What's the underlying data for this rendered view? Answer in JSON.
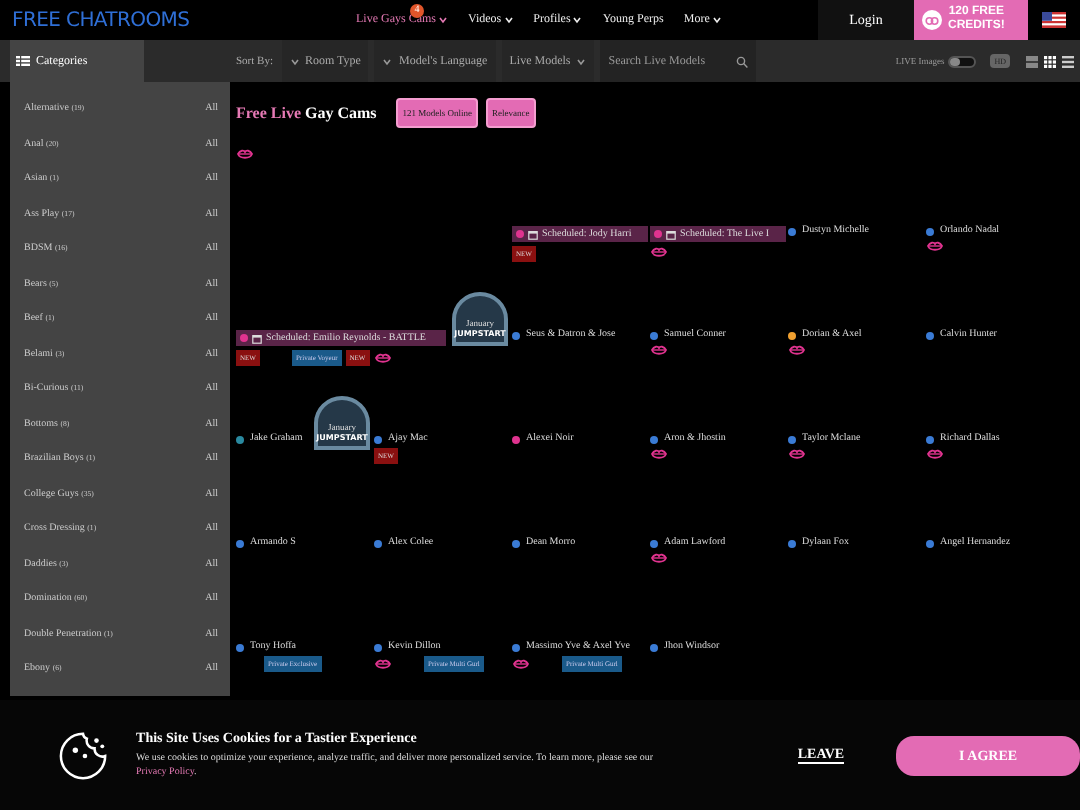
{
  "header": {
    "logo": "FREE CHATROOMS",
    "nav": [
      {
        "label": "Live Gays Cams",
        "selected": true,
        "dropdown": true,
        "badge": "4"
      },
      {
        "label": "Videos",
        "selected": false,
        "dropdown": true
      },
      {
        "label": "Profiles",
        "selected": false,
        "dropdown": true
      },
      {
        "label": "Young Perps",
        "selected": false,
        "dropdown": false
      },
      {
        "label": "More",
        "selected": false,
        "dropdown": true
      }
    ],
    "login": "Login",
    "credits": {
      "line1": "120 FREE",
      "line2": "CREDITS!"
    }
  },
  "toolbar": {
    "categories": "Categories",
    "sort_label": "Sort By:",
    "filters": [
      "Room Type",
      "Model's Language",
      "Live Models"
    ],
    "search": {
      "placeholder": "Search Live Models"
    },
    "live_images": {
      "label": "LIVE Images",
      "on": false
    },
    "hd": "HD"
  },
  "sidebar": {
    "items": [
      {
        "name": "Alternative",
        "count": "(19)",
        "all": "All"
      },
      {
        "name": "Anal",
        "count": "(20)",
        "all": "All"
      },
      {
        "name": "Asian",
        "count": "(1)",
        "all": "All"
      },
      {
        "name": "Ass Play",
        "count": "(17)",
        "all": "All"
      },
      {
        "name": "BDSM",
        "count": "(16)",
        "all": "All"
      },
      {
        "name": "Bears",
        "count": "(5)",
        "all": "All"
      },
      {
        "name": "Beef",
        "count": "(1)",
        "all": "All"
      },
      {
        "name": "Belami",
        "count": "(3)",
        "all": "All"
      },
      {
        "name": "Bi-Curious",
        "count": "(11)",
        "all": "All"
      },
      {
        "name": "Bottoms",
        "count": "(8)",
        "all": "All"
      },
      {
        "name": "Brazilian Boys",
        "count": "(1)",
        "all": "All"
      },
      {
        "name": "College Guys",
        "count": "(35)",
        "all": "All"
      },
      {
        "name": "Cross Dressing",
        "count": "(1)",
        "all": "All"
      },
      {
        "name": "Daddies",
        "count": "(3)",
        "all": "All"
      },
      {
        "name": "Domination",
        "count": "(60)",
        "all": "All"
      },
      {
        "name": "Double Penetration",
        "count": "(1)",
        "all": "All"
      },
      {
        "name": "Ebony",
        "count": "(6)",
        "all": "All"
      }
    ]
  },
  "main": {
    "title_accent": "Free Live",
    "title": "Gay Cams",
    "pills": [
      "121 Models Online",
      "Relevance"
    ]
  },
  "grid": [
    [
      {
        "kind": "blank"
      },
      {
        "kind": "blank"
      },
      {
        "kind": "scheduled",
        "name": "Scheduled: Jody Harri",
        "color": "#e0338f",
        "tags": [
          {
            "kind": "new",
            "text": "NEW"
          }
        ]
      },
      {
        "kind": "scheduled",
        "name": "Scheduled: The Live I",
        "color": "#e0338f",
        "tags": [
          {
            "kind": "lips"
          }
        ]
      },
      {
        "kind": "model",
        "name": "Dustyn Michelle",
        "color": "#3a7bd5"
      },
      {
        "kind": "model",
        "name": "Orlando Nadal",
        "color": "#3a7bd5",
        "tags": [
          {
            "kind": "lips"
          }
        ]
      }
    ],
    [
      {
        "kind": "scheduled",
        "name": "Scheduled: Emilio Reynolds - BATTLE",
        "color": "#e0338f",
        "wide": true,
        "promo": {
          "line1": "January",
          "line2": "JUMPSTART"
        },
        "tags": [
          {
            "kind": "new",
            "text": "NEW"
          },
          {
            "kind": "gap"
          },
          {
            "kind": "private",
            "text": "Private Voyeur"
          },
          {
            "kind": "new",
            "text": "NEW"
          },
          {
            "kind": "lips"
          }
        ]
      },
      {
        "kind": "model",
        "name": "Seus & Datron & Jose",
        "color": "#3a7bd5"
      },
      {
        "kind": "model",
        "name": "Samuel Conner",
        "color": "#3a7bd5",
        "tags": [
          {
            "kind": "lips"
          }
        ]
      },
      {
        "kind": "model",
        "name": "Dorian & Axel",
        "color": "#f0a030",
        "tags": [
          {
            "kind": "lips"
          }
        ]
      },
      {
        "kind": "model",
        "name": "Calvin Hunter",
        "color": "#3a7bd5"
      }
    ],
    [
      {
        "kind": "model",
        "name": "Jake Graham",
        "color": "#2a8aa0",
        "promo": {
          "line1": "January",
          "line2": "JUMPSTART"
        }
      },
      {
        "kind": "model",
        "name": "Ajay Mac",
        "color": "#3a7bd5",
        "tags": [
          {
            "kind": "new",
            "text": "NEW"
          }
        ]
      },
      {
        "kind": "model",
        "name": "Alexei Noir",
        "color": "#e0338f"
      },
      {
        "kind": "model",
        "name": "Aron & Jhostin",
        "color": "#3a7bd5",
        "tags": [
          {
            "kind": "lips"
          }
        ]
      },
      {
        "kind": "model",
        "name": "Taylor Mclane",
        "color": "#3a7bd5",
        "tags": [
          {
            "kind": "lips"
          }
        ]
      },
      {
        "kind": "model",
        "name": "Richard Dallas",
        "color": "#3a7bd5",
        "tags": [
          {
            "kind": "lips"
          }
        ]
      }
    ],
    [
      {
        "kind": "model",
        "name": "Armando S",
        "color": "#3a7bd5"
      },
      {
        "kind": "model",
        "name": "Alex Colee",
        "color": "#3a7bd5"
      },
      {
        "kind": "model",
        "name": "Dean Morro",
        "color": "#3a7bd5"
      },
      {
        "kind": "model",
        "name": "Adam Lawford",
        "color": "#3a7bd5",
        "tags": [
          {
            "kind": "lips"
          }
        ]
      },
      {
        "kind": "model",
        "name": "Dylaan Fox",
        "color": "#3a7bd5"
      },
      {
        "kind": "model",
        "name": "Angel Hernandez",
        "color": "#3a7bd5"
      }
    ],
    [
      {
        "kind": "model",
        "name": "Tony Hoffa",
        "color": "#3a7bd5",
        "tags": [
          {
            "kind": "gap"
          },
          {
            "kind": "private",
            "text": "Private Exclusive"
          }
        ]
      },
      {
        "kind": "model",
        "name": "Kevin Dillon",
        "color": "#3a7bd5",
        "tags": [
          {
            "kind": "lips"
          },
          {
            "kind": "gap"
          },
          {
            "kind": "private",
            "text": "Private Multi Gurl"
          }
        ]
      },
      {
        "kind": "model",
        "name": "Massimo Yve & Axel Yve",
        "color": "#3a7bd5",
        "tags": [
          {
            "kind": "lips"
          },
          {
            "kind": "gap"
          },
          {
            "kind": "private",
            "text": "Private Multi Gurl"
          }
        ]
      },
      {
        "kind": "model",
        "name": "Jhon Windsor",
        "color": "#3a7bd5"
      }
    ]
  ],
  "cookie": {
    "title": "This Site Uses Cookies for a Tastier Experience",
    "text": "We use cookies to optimize your experience, analyze traffic, and deliver more personalized service. To learn more, please see our ",
    "link": "Privacy Policy",
    "end": ".",
    "leave": "LEAVE",
    "agree": "I AGREE"
  }
}
